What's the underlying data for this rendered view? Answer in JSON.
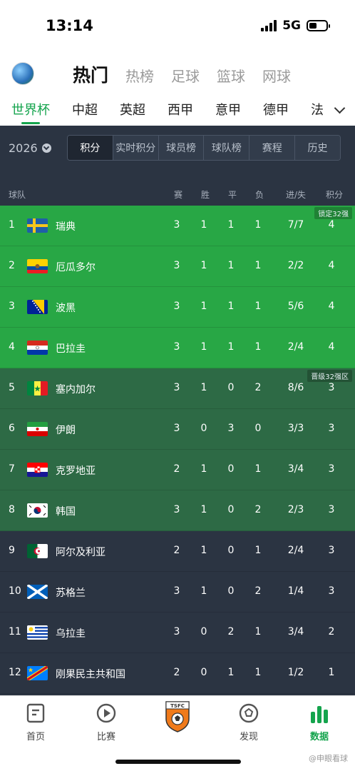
{
  "status": {
    "time": "13:14",
    "network": "5G"
  },
  "nav": {
    "tabs": [
      "热门",
      "热榜",
      "足球",
      "篮球",
      "网球"
    ],
    "active": 0
  },
  "leagues": {
    "tabs": [
      "世界杯",
      "中超",
      "英超",
      "西甲",
      "意甲",
      "德甲",
      "法"
    ],
    "active": 0
  },
  "filter": {
    "season": "2026",
    "segments": [
      "积分",
      "实时积分",
      "球员榜",
      "球队榜",
      "赛程",
      "历史"
    ],
    "active": 0
  },
  "table": {
    "headers": {
      "team": "球队",
      "played": "赛",
      "win": "胜",
      "draw": "平",
      "loss": "负",
      "goals": "进/失",
      "points": "积分"
    },
    "zones": [
      {
        "badge": "锁定32强",
        "color": "#28a745"
      },
      {
        "badge": "晋级32强区",
        "color": "#2d6a45"
      },
      {
        "badge": "",
        "color": "#2b3442"
      }
    ],
    "rows": [
      {
        "rank": "1",
        "team": "瑞典",
        "flag": "sweden",
        "p": "3",
        "w": "1",
        "d": "1",
        "l": "1",
        "gd": "7/7",
        "pts": "4"
      },
      {
        "rank": "2",
        "team": "厄瓜多尔",
        "flag": "ecuador",
        "p": "3",
        "w": "1",
        "d": "1",
        "l": "1",
        "gd": "2/2",
        "pts": "4"
      },
      {
        "rank": "3",
        "team": "波黑",
        "flag": "bosnia",
        "p": "3",
        "w": "1",
        "d": "1",
        "l": "1",
        "gd": "5/6",
        "pts": "4"
      },
      {
        "rank": "4",
        "team": "巴拉圭",
        "flag": "paraguay",
        "p": "3",
        "w": "1",
        "d": "1",
        "l": "1",
        "gd": "2/4",
        "pts": "4"
      },
      {
        "rank": "5",
        "team": "塞内加尔",
        "flag": "senegal",
        "p": "3",
        "w": "1",
        "d": "0",
        "l": "2",
        "gd": "8/6",
        "pts": "3"
      },
      {
        "rank": "6",
        "team": "伊朗",
        "flag": "iran",
        "p": "3",
        "w": "0",
        "d": "3",
        "l": "0",
        "gd": "3/3",
        "pts": "3"
      },
      {
        "rank": "7",
        "team": "克罗地亚",
        "flag": "croatia",
        "p": "2",
        "w": "1",
        "d": "0",
        "l": "1",
        "gd": "3/4",
        "pts": "3"
      },
      {
        "rank": "8",
        "team": "韩国",
        "flag": "korea",
        "p": "3",
        "w": "1",
        "d": "0",
        "l": "2",
        "gd": "2/3",
        "pts": "3"
      },
      {
        "rank": "9",
        "team": "阿尔及利亚",
        "flag": "algeria",
        "p": "2",
        "w": "1",
        "d": "0",
        "l": "1",
        "gd": "2/4",
        "pts": "3"
      },
      {
        "rank": "10",
        "team": "苏格兰",
        "flag": "scotland",
        "p": "3",
        "w": "1",
        "d": "0",
        "l": "2",
        "gd": "1/4",
        "pts": "3"
      },
      {
        "rank": "11",
        "team": "乌拉圭",
        "flag": "uruguay",
        "p": "3",
        "w": "0",
        "d": "2",
        "l": "1",
        "gd": "3/4",
        "pts": "2"
      },
      {
        "rank": "12",
        "team": "刚果民主共和国",
        "flag": "dr-congo",
        "p": "2",
        "w": "0",
        "d": "1",
        "l": "1",
        "gd": "1/2",
        "pts": "1"
      }
    ]
  },
  "tabbar": {
    "items": [
      {
        "label": "首页",
        "icon": "home-doc-icon"
      },
      {
        "label": "比赛",
        "icon": "play-circle-icon"
      },
      {
        "label": "",
        "icon": "club-crest-icon"
      },
      {
        "label": "发现",
        "icon": "football-icon"
      },
      {
        "label": "数据",
        "icon": "bar-chart-icon"
      }
    ],
    "active": 4
  },
  "watermark": "@申眼看球"
}
